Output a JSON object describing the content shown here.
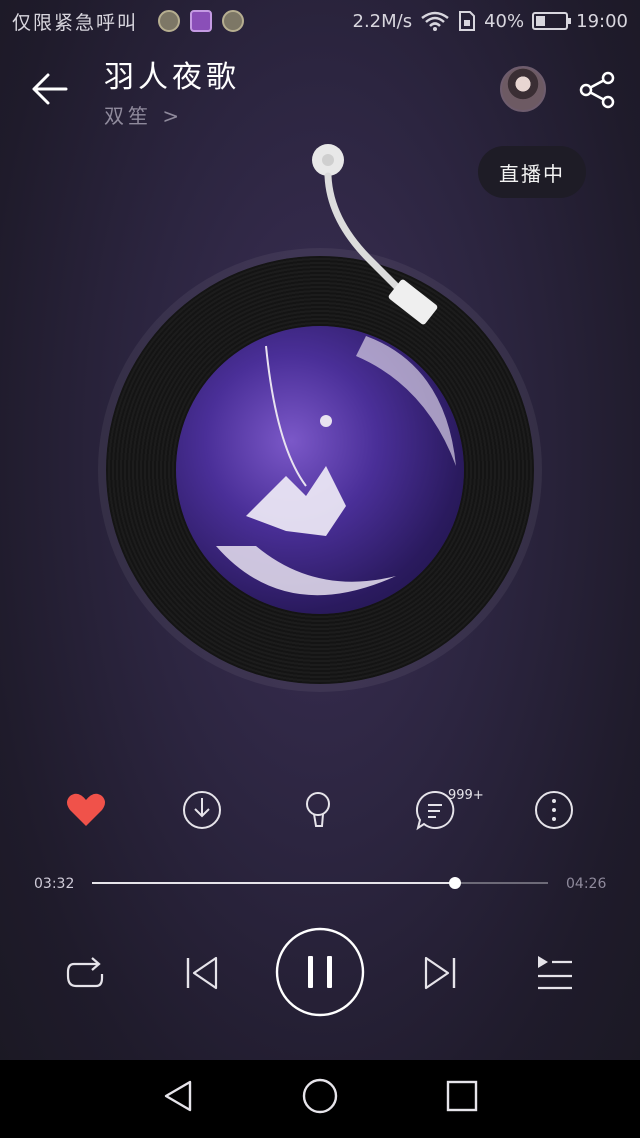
{
  "status_bar": {
    "carrier": "仅限紧急呼叫",
    "speed": "2.2M/s",
    "battery": "40%",
    "battery_level": 0.4,
    "time": "19:00"
  },
  "header": {
    "title": "羽人夜歌",
    "artist": "双笙 >",
    "live_label": "直播中"
  },
  "actions": {
    "comment_count": "999+"
  },
  "progress": {
    "current": "03:32",
    "total": "04:26",
    "fraction": 0.797
  },
  "icons": [
    "back-arrow-icon",
    "share-icon",
    "heart-icon",
    "download-icon",
    "mic-icon",
    "comment-icon",
    "more-icon",
    "repeat-icon",
    "prev-icon",
    "pause-icon",
    "next-icon",
    "playlist-icon",
    "nav-back-icon",
    "nav-home-icon",
    "nav-recents-icon"
  ],
  "colors": {
    "accent": "#f0524a",
    "background": "#2c2540"
  }
}
